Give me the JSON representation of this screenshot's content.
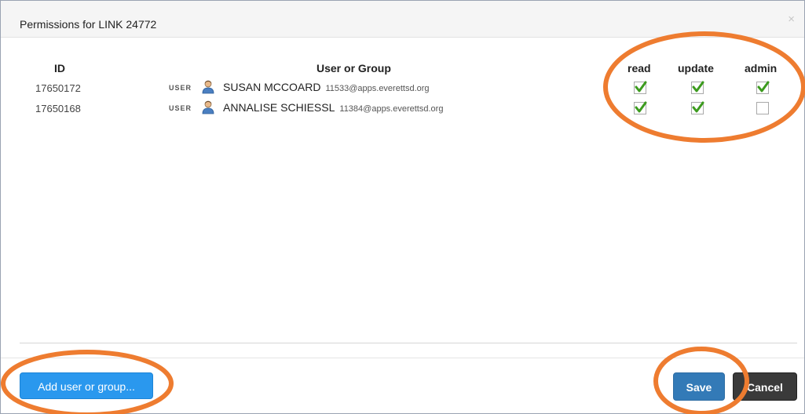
{
  "dialog": {
    "title": "Permissions for LINK 24772",
    "close_glyph": "×"
  },
  "table": {
    "headers": {
      "id": "ID",
      "user_or_group": "User or Group",
      "read": "read",
      "update": "update",
      "admin": "admin"
    },
    "rows": [
      {
        "id": "17650172",
        "kind": "USER",
        "name": "SUSAN MCCOARD",
        "email": "11533@apps.everettsd.org",
        "icon": "user-icon",
        "read": true,
        "update": true,
        "admin": true
      },
      {
        "id": "17650168",
        "kind": "USER",
        "name": "ANNALISE SCHIESSL",
        "email": "11384@apps.everettsd.org",
        "icon": "user-icon",
        "read": true,
        "update": true,
        "admin": false
      }
    ]
  },
  "footer": {
    "add_label": "Add user or group...",
    "save_label": "Save",
    "cancel_label": "Cancel"
  },
  "colors": {
    "check": "#3c9b1e",
    "annotation": "#ee7c30",
    "save": "#337ab7",
    "add": "#2a98ee"
  }
}
